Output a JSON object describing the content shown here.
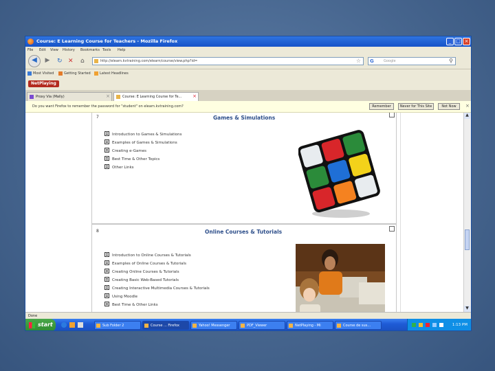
{
  "window": {
    "title": "Course: E Learning Course for Teachers - Mozilla Firefox"
  },
  "menu": [
    "File",
    "Edit",
    "View",
    "History",
    "Bookmarks",
    "Tools",
    "Help"
  ],
  "address": {
    "url": "http://elearn.kvtraining.com/elearn/course/view.php?id=",
    "search_placeholder": "Google"
  },
  "bookmarks": [
    "Most Visited",
    "Getting Started",
    "Latest Headlines"
  ],
  "addon": {
    "label": "NetPlaying"
  },
  "tabs": [
    {
      "label": "Proxy Via (Mally)"
    },
    {
      "label": "Course: E Learning Course for Te..."
    }
  ],
  "notification": {
    "message": "Do you want Firefox to remember the password for \"student\" on elearn.kvtraining.com?",
    "buttons": [
      "Remember",
      "Never for This Site",
      "Not Now"
    ]
  },
  "topics": [
    {
      "number": "7",
      "heading": "Games & Simulations",
      "items": [
        "Introduction to Games & Simulations",
        "Examples of Games & Simulations",
        "Creating e-Games",
        "Best Time & Other Topics",
        "Other Links"
      ]
    },
    {
      "number": "8",
      "heading": "Online Courses & Tutorials",
      "items": [
        "Introduction to Online Courses & Tutorials",
        "Examples of Online Courses & Tutorials",
        "Creating Online Courses & Tutorials",
        "Creating Basic Web-Based Tutorials",
        "Creating Interactive Multimedia Courses & Tutorials",
        "Using Moodle",
        "Best Time & Other Links"
      ]
    }
  ],
  "status": {
    "text": "Done"
  },
  "taskbar": {
    "start_label": "start",
    "items": [
      "Sub Folder 2",
      "Course ... Firefox",
      "Yahoo! Messenger",
      "PDF_Viewer",
      "NetPlaying - Mi",
      "Course de sus..."
    ],
    "clock": "1:13 PM"
  },
  "colors": {
    "accent": "#1653c8",
    "heading": "#2d4e8a",
    "taskbar": "#1e5bd6",
    "start": "#2f8a2f"
  }
}
